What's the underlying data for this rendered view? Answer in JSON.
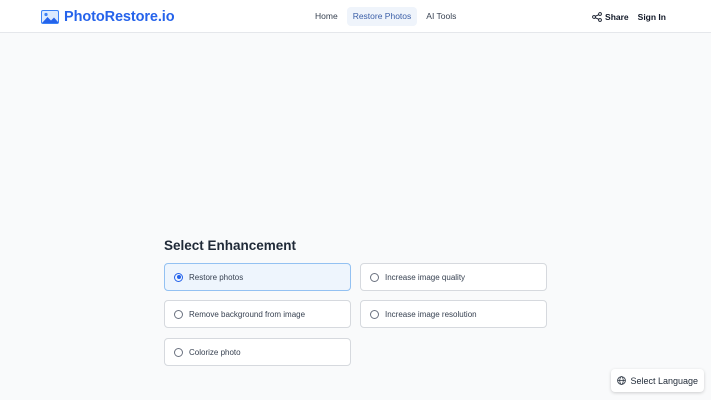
{
  "header": {
    "logo_text": "PhotoRestore.io",
    "nav": [
      {
        "label": "Home",
        "active": false
      },
      {
        "label": "Restore Photos",
        "active": true
      },
      {
        "label": "AI Tools",
        "active": false
      }
    ],
    "share_label": "Share",
    "signin_label": "Sign In"
  },
  "main": {
    "title": "Select Enhancement",
    "options": [
      {
        "label": "Restore photos",
        "selected": true
      },
      {
        "label": "Increase image quality",
        "selected": false
      },
      {
        "label": "Remove background from image",
        "selected": false
      },
      {
        "label": "Increase image resolution",
        "selected": false
      },
      {
        "label": "Colorize photo",
        "selected": false
      }
    ]
  },
  "footer": {
    "language_label": "Select Language"
  },
  "colors": {
    "brand": "#2563eb",
    "selected_bg": "#eef5fd",
    "selected_border": "#93c1f2",
    "nav_active_bg": "#eff4fb"
  },
  "icons": {
    "logo": "image-icon",
    "share": "share-icon",
    "language": "globe-icon"
  }
}
